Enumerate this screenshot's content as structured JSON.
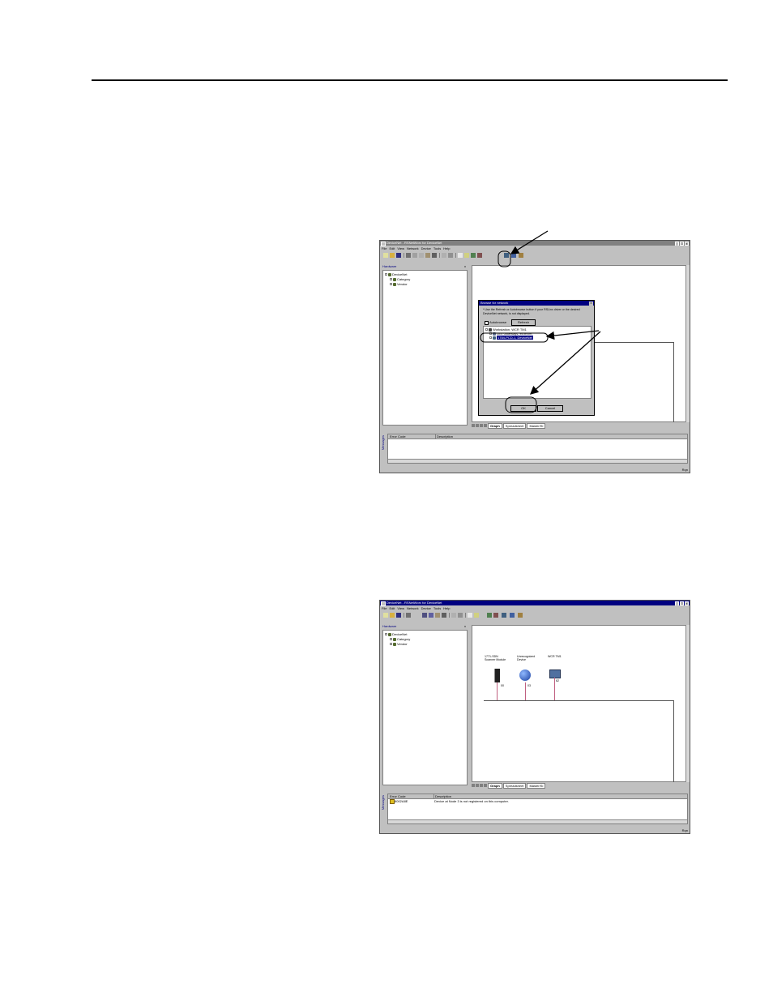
{
  "screenshot1": {
    "window_title": "DeviceNet - RSNetWorx for DeviceNet",
    "menu": [
      "File",
      "Edit",
      "View",
      "Network",
      "Device",
      "Tools",
      "Help"
    ],
    "hardware_title": "Hardware",
    "tree": [
      "DeviceNet",
      "Category",
      "Vendor"
    ],
    "tabs": [
      "Graph",
      "Spreadsheet",
      "Master/Sl"
    ],
    "messages_columns": [
      "Error Code",
      "Description"
    ],
    "messages_side": "Messages",
    "status": "Rqn",
    "dialog": {
      "title": "Browse for network",
      "instructions": "* Use the Refresh or Autobrowse button if your RSLinx driver or the desired DeviceNet network, is not displayed.",
      "autobrowse_label": "Autobrowse",
      "refresh_label": "Refresh",
      "tree": [
        "Workstation, WCR TM1",
        "Linx Gateways, Ethernet",
        "1784-PCD-1, DeviceNet"
      ],
      "ok_label": "OK",
      "cancel_label": "Cancel"
    }
  },
  "screenshot2": {
    "window_title": "DeviceNet - RSNetWorx for DeviceNet",
    "menu": [
      "File",
      "Edit",
      "View",
      "Network",
      "Device",
      "Tools",
      "Help"
    ],
    "hardware_title": "Hardware",
    "tree": [
      "DeviceNet",
      "Category",
      "Vendor"
    ],
    "tabs": [
      "Graph",
      "Spreadsheet",
      "Master/Sl"
    ],
    "devices": [
      {
        "label1": "1771-SDN",
        "label2": "Scanner Module",
        "node": "00"
      },
      {
        "label1": "Unrecognized",
        "label2": "Device",
        "node": "03"
      },
      {
        "label1": "WCR TM1",
        "label2": "",
        "node": "62"
      }
    ],
    "messages_columns": [
      "Error Code",
      "Description"
    ],
    "message": {
      "code": "8002A8E",
      "description": "Device at Node 3 is not registered on this computer."
    },
    "messages_side": "Messages",
    "status": "Rqn"
  },
  "colors": {
    "titlebar_active": "#000080",
    "titlebar_inactive": "#808080",
    "chrome": "#c0c0c0"
  }
}
